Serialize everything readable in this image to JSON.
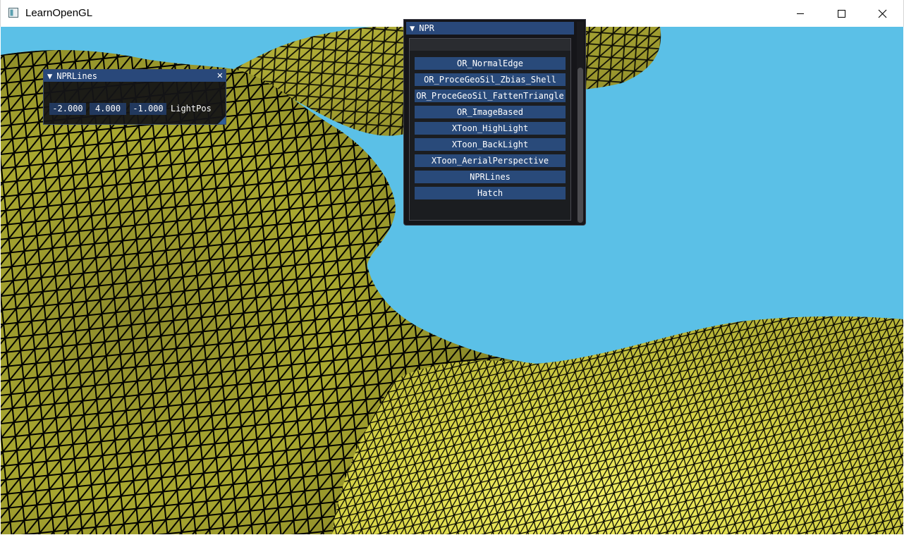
{
  "window": {
    "title": "LearnOpenGL",
    "controls": [
      "minimize",
      "maximize",
      "close"
    ],
    "icon": "app-window-icon"
  },
  "scene": {
    "background_color": "#5bc0e7",
    "mesh_color": "#c8c832",
    "wire_color": "#000000"
  },
  "npr_lines_panel": {
    "title": "NPRLines",
    "collapse_icon": "▼",
    "close_icon": "✕",
    "fields": [
      "-2.000",
      "4.000",
      "-1.000"
    ],
    "field_label": "LightPos"
  },
  "npr_panel": {
    "title": "NPR",
    "collapse_icon": "▼",
    "buttons": [
      "OR_NormalEdge",
      "OR_ProceGeoSil_Zbias_Shell",
      "OR_ProceGeoSil_FattenTriangle",
      "OR_ImageBased",
      "XToon_HighLight",
      "XToon_BackLight",
      "XToon_AerialPerspective",
      "NPRLines",
      "Hatch"
    ]
  }
}
